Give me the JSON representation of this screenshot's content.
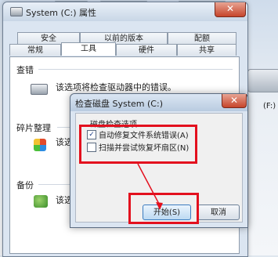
{
  "properties_window": {
    "title": "System (C:) 属性",
    "close": "✕",
    "tabs_row1": [
      "安全",
      "以前的版本",
      "配额"
    ],
    "tabs_row2": [
      "常规",
      "工具",
      "硬件",
      "共享"
    ],
    "active_tab": "工具",
    "sections": {
      "error_check": {
        "title": "查错",
        "text": "该选项将检查驱动器中的错误。"
      },
      "defrag": {
        "title": "碎片整理",
        "text": "该选"
      },
      "backup": {
        "title": "备份",
        "text": "该选"
      }
    }
  },
  "desktop": {
    "drive_label": "(F:)"
  },
  "check_disk_dialog": {
    "title": "检查磁盘 System (C:)",
    "close": "✕",
    "group_label": "磁盘检查选项",
    "options": [
      {
        "label": "自动修复文件系统错误(A)",
        "checked": true
      },
      {
        "label": "扫描并尝试恢复坏扇区(N)",
        "checked": false
      }
    ],
    "start_button": "开始(S)",
    "cancel_button": "取消"
  },
  "colors": {
    "annotation": "#e3101e",
    "window_frame": "#dbe5f1",
    "close_button": "#c6452b"
  }
}
